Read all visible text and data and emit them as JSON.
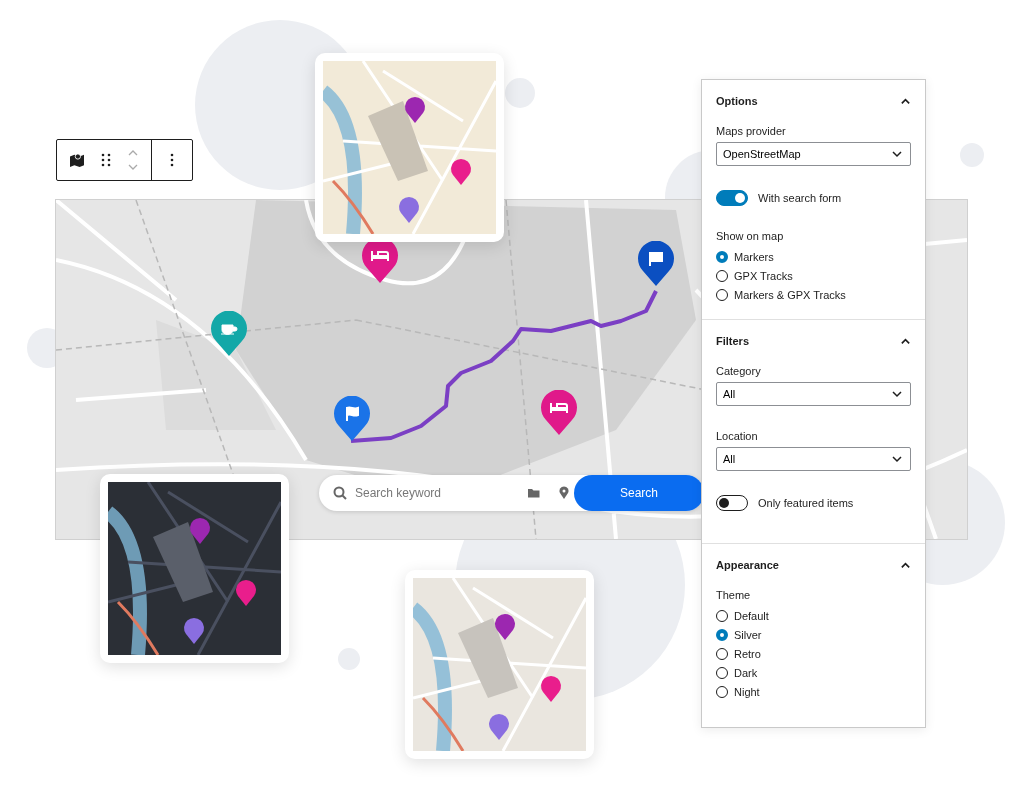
{
  "search_form": {
    "placeholder": "Search keyword",
    "button": "Search"
  },
  "map": {
    "markers": [
      {
        "kind": "cafe",
        "color": "#13a8a8"
      },
      {
        "kind": "hotel",
        "color": "#e0198a"
      },
      {
        "kind": "start",
        "color": "#1a73e8"
      },
      {
        "kind": "hotel",
        "color": "#e0198a"
      },
      {
        "kind": "finish",
        "color": "#0b4fc1"
      }
    ]
  },
  "sidebar": {
    "sections": [
      {
        "title": "Options",
        "expanded": true,
        "controls": [
          {
            "kind": "select",
            "label": "Maps provider",
            "value": "OpenStreetMap"
          },
          {
            "kind": "toggle",
            "label": "With search form",
            "on": true
          },
          {
            "kind": "radio",
            "label": "Show on map",
            "options": [
              {
                "label": "Markers",
                "selected": true
              },
              {
                "label": "GPX Tracks",
                "selected": false
              },
              {
                "label": "Markers & GPX Tracks",
                "selected": false
              }
            ]
          }
        ]
      },
      {
        "title": "Filters",
        "expanded": true,
        "controls": [
          {
            "kind": "select",
            "label": "Category",
            "value": "All"
          },
          {
            "kind": "select",
            "label": "Location",
            "value": "All"
          },
          {
            "kind": "toggle",
            "label": "Only featured items",
            "on": false
          }
        ]
      },
      {
        "title": "Appearance",
        "expanded": true,
        "controls": [
          {
            "kind": "radio",
            "label": "Theme",
            "options": [
              {
                "label": "Default",
                "selected": false
              },
              {
                "label": "Silver",
                "selected": true
              },
              {
                "label": "Retro",
                "selected": false
              },
              {
                "label": "Dark",
                "selected": false
              },
              {
                "label": "Night",
                "selected": false
              }
            ]
          }
        ]
      }
    ]
  }
}
